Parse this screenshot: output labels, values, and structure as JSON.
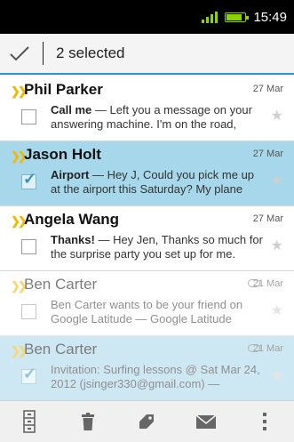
{
  "status_bar": {
    "time": "15:49",
    "battery_level": 0.85,
    "signal_bars": 4
  },
  "action_bar": {
    "selected_text": "2 selected"
  },
  "emails": [
    {
      "sender": "Phil Parker",
      "date": "27 Mar",
      "subject": "Call me",
      "snippet": " — Left you a message on your answering machine. I'm on the road,",
      "selected": false,
      "important": true,
      "bold": true,
      "faded": false,
      "attachment": false
    },
    {
      "sender": "Jason Holt",
      "date": "27 Mar",
      "subject": "Airport",
      "snippet": " — Hey J, Could you pick me up at the airport this Saturday? My plane",
      "selected": true,
      "important": true,
      "bold": true,
      "faded": false,
      "attachment": false
    },
    {
      "sender": "Angela Wang",
      "date": "27 Mar",
      "subject": "Thanks!",
      "snippet": " — Hey Jen, Thanks so much for the surprise party you set up for me.",
      "selected": false,
      "important": true,
      "bold": true,
      "faded": false,
      "attachment": false
    },
    {
      "sender": "Ben Carter",
      "date": "21 Mar",
      "subject": "",
      "snippet": "Ben Carter wants to be your friend on Google Latitude — Google Latitude",
      "selected": false,
      "important": true,
      "bold": false,
      "faded": true,
      "attachment": true
    },
    {
      "sender": "Ben Carter",
      "date": "21 Mar",
      "subject": "",
      "snippet": "Invitation: Surfing lessons @ Sat Mar 24, 2012 (jsinger330@gmail.com) —",
      "selected": true,
      "important": true,
      "bold": false,
      "faded": true,
      "attachment": true
    }
  ],
  "bottom_bar": {
    "icons": [
      "archive-icon",
      "trash-icon",
      "label-icon",
      "mark-unread-icon",
      "overflow-menu-icon"
    ]
  },
  "colors": {
    "accent": "#2c95c7",
    "selected_row": "#a7d7ea",
    "important_marker": "#f2b900",
    "signal": "#8bd400"
  }
}
